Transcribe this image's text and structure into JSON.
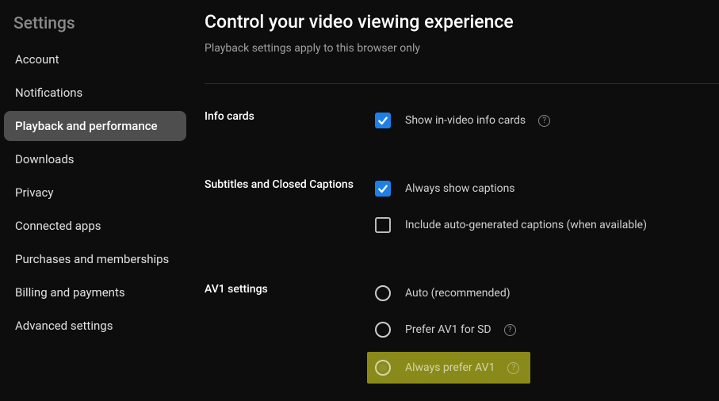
{
  "sidebar": {
    "title": "Settings",
    "items": [
      {
        "label": "Account"
      },
      {
        "label": "Notifications"
      },
      {
        "label": "Playback and performance"
      },
      {
        "label": "Downloads"
      },
      {
        "label": "Privacy"
      },
      {
        "label": "Connected apps"
      },
      {
        "label": "Purchases and memberships"
      },
      {
        "label": "Billing and payments"
      },
      {
        "label": "Advanced settings"
      }
    ],
    "active_index": 2
  },
  "page": {
    "title": "Control your video viewing experience",
    "subtitle": "Playback settings apply to this browser only"
  },
  "sections": {
    "info_cards": {
      "label": "Info cards",
      "option1": "Show in-video info cards"
    },
    "captions": {
      "label": "Subtitles and Closed Captions",
      "option1": "Always show captions",
      "option2": "Include auto-generated captions (when available)"
    },
    "av1": {
      "label": "AV1 settings",
      "option1": "Auto (recommended)",
      "option2": "Prefer AV1 for SD",
      "option3": "Always prefer AV1"
    }
  }
}
